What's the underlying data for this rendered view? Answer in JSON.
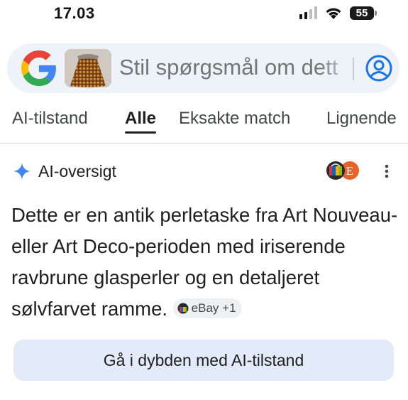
{
  "status_bar": {
    "time": "17.03",
    "battery_level": "55",
    "icons": [
      "signal-icon",
      "wifi-icon",
      "battery-icon"
    ]
  },
  "search": {
    "placeholder": "Stil spørgsmål om dett",
    "logo": "google-logo",
    "thumbnail": "beaded-bag-thumbnail",
    "account_icon": "account-icon"
  },
  "tabs": [
    {
      "label": "AI-tilstand",
      "active": false
    },
    {
      "label": "Alle",
      "active": true
    },
    {
      "label": "Eksakte match",
      "active": false
    },
    {
      "label": "Lignende",
      "active": false
    }
  ],
  "ai_overview": {
    "title": "AI-oversigt",
    "icon": "sparkle-icon",
    "summary": "Dette er en antik perletaske fra Art Nouveau- eller Art Deco-perioden med iriserende ravbrune glasperler og en detaljeret sølvfarvet ramme.",
    "source_chip": "eBay +1",
    "deep_dive_button": "Gå i dybden med AI-tilstand"
  },
  "colors": {
    "search_bg": "#eef3f9",
    "account_blue": "#1a73e8",
    "sparkle_blue": "#4285f4",
    "button_bg": "#e3ebfb"
  }
}
